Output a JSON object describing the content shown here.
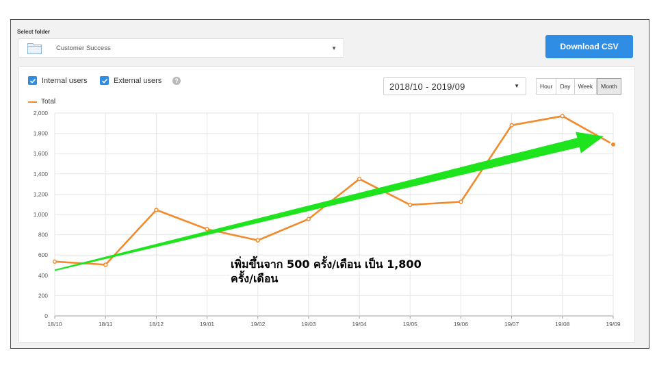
{
  "folder": {
    "label": "Select folder",
    "selected": "Customer Success",
    "icon": "folder-icon"
  },
  "toolbar": {
    "download_label": "Download CSV",
    "accent_color": "#2f8de4"
  },
  "filters": {
    "internal_label": "Internal users",
    "internal_checked": true,
    "external_label": "External users",
    "external_checked": true,
    "help_glyph": "?"
  },
  "date_range": {
    "value": "2018/10 - 2019/09"
  },
  "granularity": {
    "options": [
      "Hour",
      "Day",
      "Week",
      "Month"
    ],
    "selected": "Month"
  },
  "chart_data": {
    "type": "line",
    "x": [
      "18/10",
      "18/11",
      "18/12",
      "19/01",
      "19/02",
      "19/03",
      "19/04",
      "19/05",
      "19/06",
      "19/07",
      "19/08",
      "19/09"
    ],
    "series": [
      {
        "name": "Total",
        "color": "#f28a2b",
        "values": [
          535,
          505,
          1045,
          855,
          745,
          955,
          1350,
          1095,
          1125,
          1880,
          1970,
          1690
        ]
      }
    ],
    "ylim": [
      0,
      2000
    ],
    "yticks": [
      "0",
      "200",
      "400",
      "600",
      "800",
      "1,000",
      "1,200",
      "1,400",
      "1,600",
      "1,800",
      "2,000"
    ],
    "grid": true,
    "legend": "top-left",
    "trend_arrow": {
      "color": "#1ee41e",
      "from": [
        "18/10",
        450
      ],
      "to": [
        "19/09",
        1770
      ]
    }
  },
  "annotation": {
    "line1": "เพิ่มขึ้นจาก 500 ครั้ง/เดือน เป็น 1,800",
    "line2": "ครั้ง/เดือน"
  }
}
